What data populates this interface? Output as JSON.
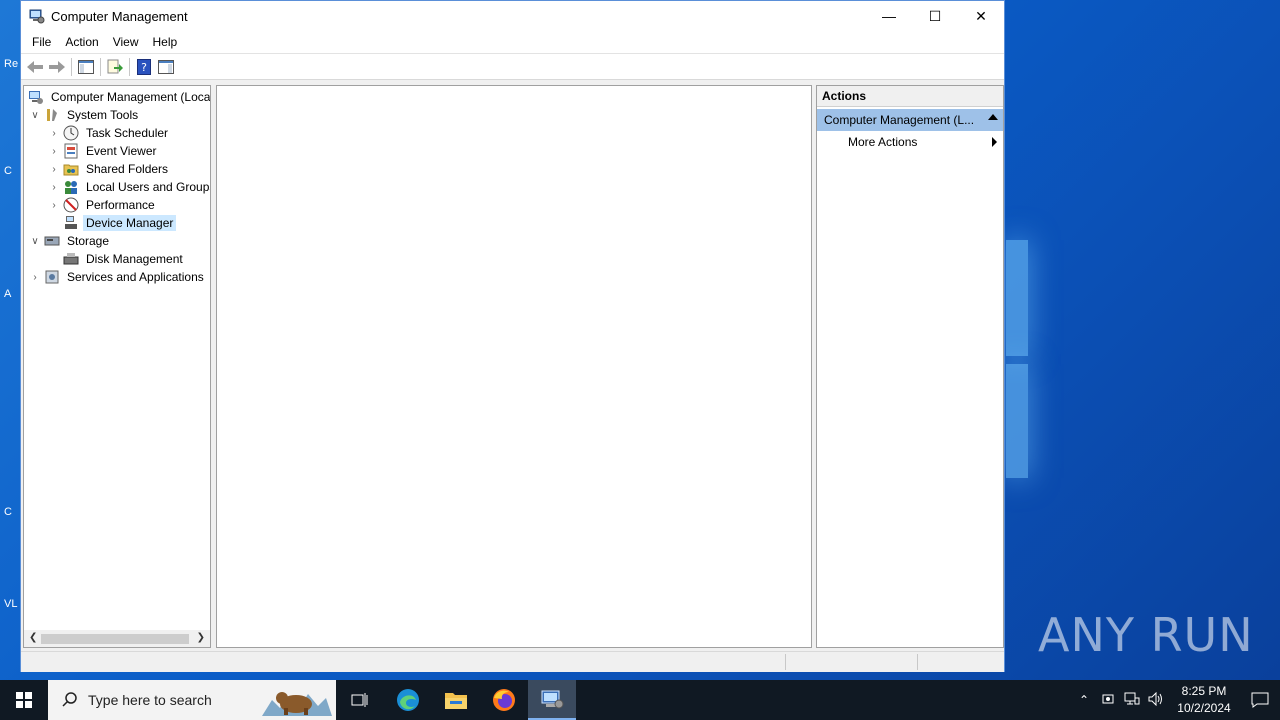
{
  "window": {
    "title": "Computer Management",
    "minimize_glyph": "—",
    "maximize_glyph": "☐",
    "close_glyph": "✕"
  },
  "menu": [
    "File",
    "Action",
    "View",
    "Help"
  ],
  "toolbar": {
    "icons": [
      "back-arrow-icon",
      "forward-arrow-icon",
      "show-hide-console-tree-icon",
      "export-list-icon",
      "help-icon",
      "show-hide-action-pane-icon"
    ]
  },
  "tree": {
    "root": "Computer Management (Local",
    "system_tools": "System Tools",
    "task_scheduler": "Task Scheduler",
    "event_viewer": "Event Viewer",
    "shared_folders": "Shared Folders",
    "local_users": "Local Users and Groups",
    "performance": "Performance",
    "device_manager": "Device Manager",
    "storage": "Storage",
    "disk_management": "Disk Management",
    "services": "Services and Applications",
    "selected": "Device Manager"
  },
  "actions": {
    "header": "Actions",
    "group_label": "Computer Management (L...",
    "more_actions": "More Actions"
  },
  "taskbar": {
    "search_placeholder": "Type here to search",
    "time": "8:25 PM",
    "date": "10/2/2024",
    "apps": [
      "task-view-icon",
      "edge-icon",
      "file-explorer-icon",
      "firefox-icon",
      "computer-management-icon"
    ]
  },
  "desktop": {
    "watermark": "ANY RUN",
    "icon_labels": [
      "Re",
      "C",
      "A",
      "C",
      "VL"
    ]
  },
  "colors": {
    "selection": "#cce8ff",
    "actions_group": "#9ec1e8",
    "taskbar": "#101923",
    "desktop": "#0a5cc7"
  }
}
